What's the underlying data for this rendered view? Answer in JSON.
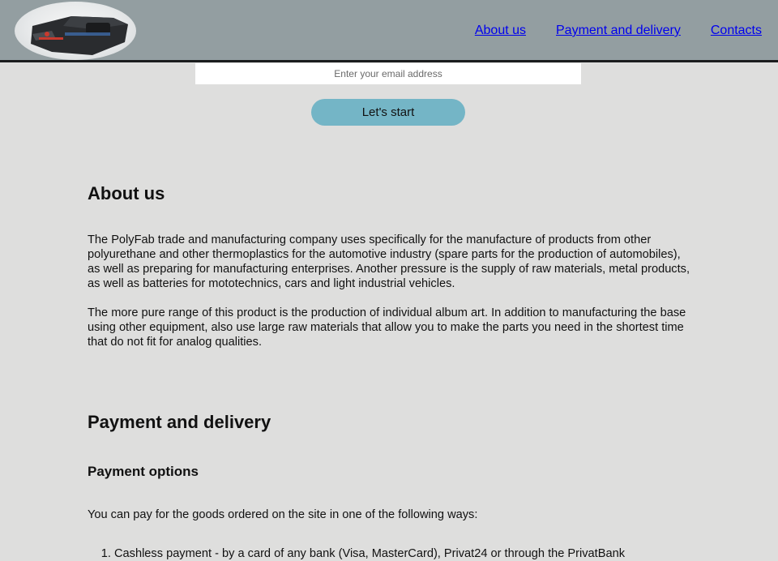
{
  "header": {
    "logo_alt": "PolyFab logo",
    "nav": [
      {
        "label": "About us"
      },
      {
        "label": "Payment and delivery"
      },
      {
        "label": "Contacts"
      }
    ]
  },
  "signup": {
    "email_placeholder": "Enter your email address",
    "email_value": "",
    "button_label": "Let's start"
  },
  "about": {
    "heading": "About us",
    "paragraphs": [
      "The PolyFab trade and manufacturing company uses specifically for the manufacture of products from other polyurethane and other thermoplastics for the automotive industry (spare parts for the production of automobiles), as well as preparing for manufacturing enterprises. Another pressure is the supply of raw materials, metal products, as well as batteries for mototechnics, cars and light industrial vehicles.",
      "The more pure range of this product is the production of individual album art. In addition to manufacturing the base using other equipment, also use large raw materials that allow you to make the parts you need in the shortest time that do not fit for analog qualities."
    ]
  },
  "payment": {
    "heading": "Payment and delivery",
    "subheading": "Payment options",
    "intro": "You can pay for the goods ordered on the site in one of the following ways:",
    "options": [
      "Cashless payment - by a card of any bank (Visa, MasterCard), Privat24 or through the PrivatBank"
    ]
  },
  "colors": {
    "header_bg": "#939ea1",
    "page_bg": "#dededd",
    "button_bg": "#74b5c6",
    "link": "#0000ee"
  }
}
